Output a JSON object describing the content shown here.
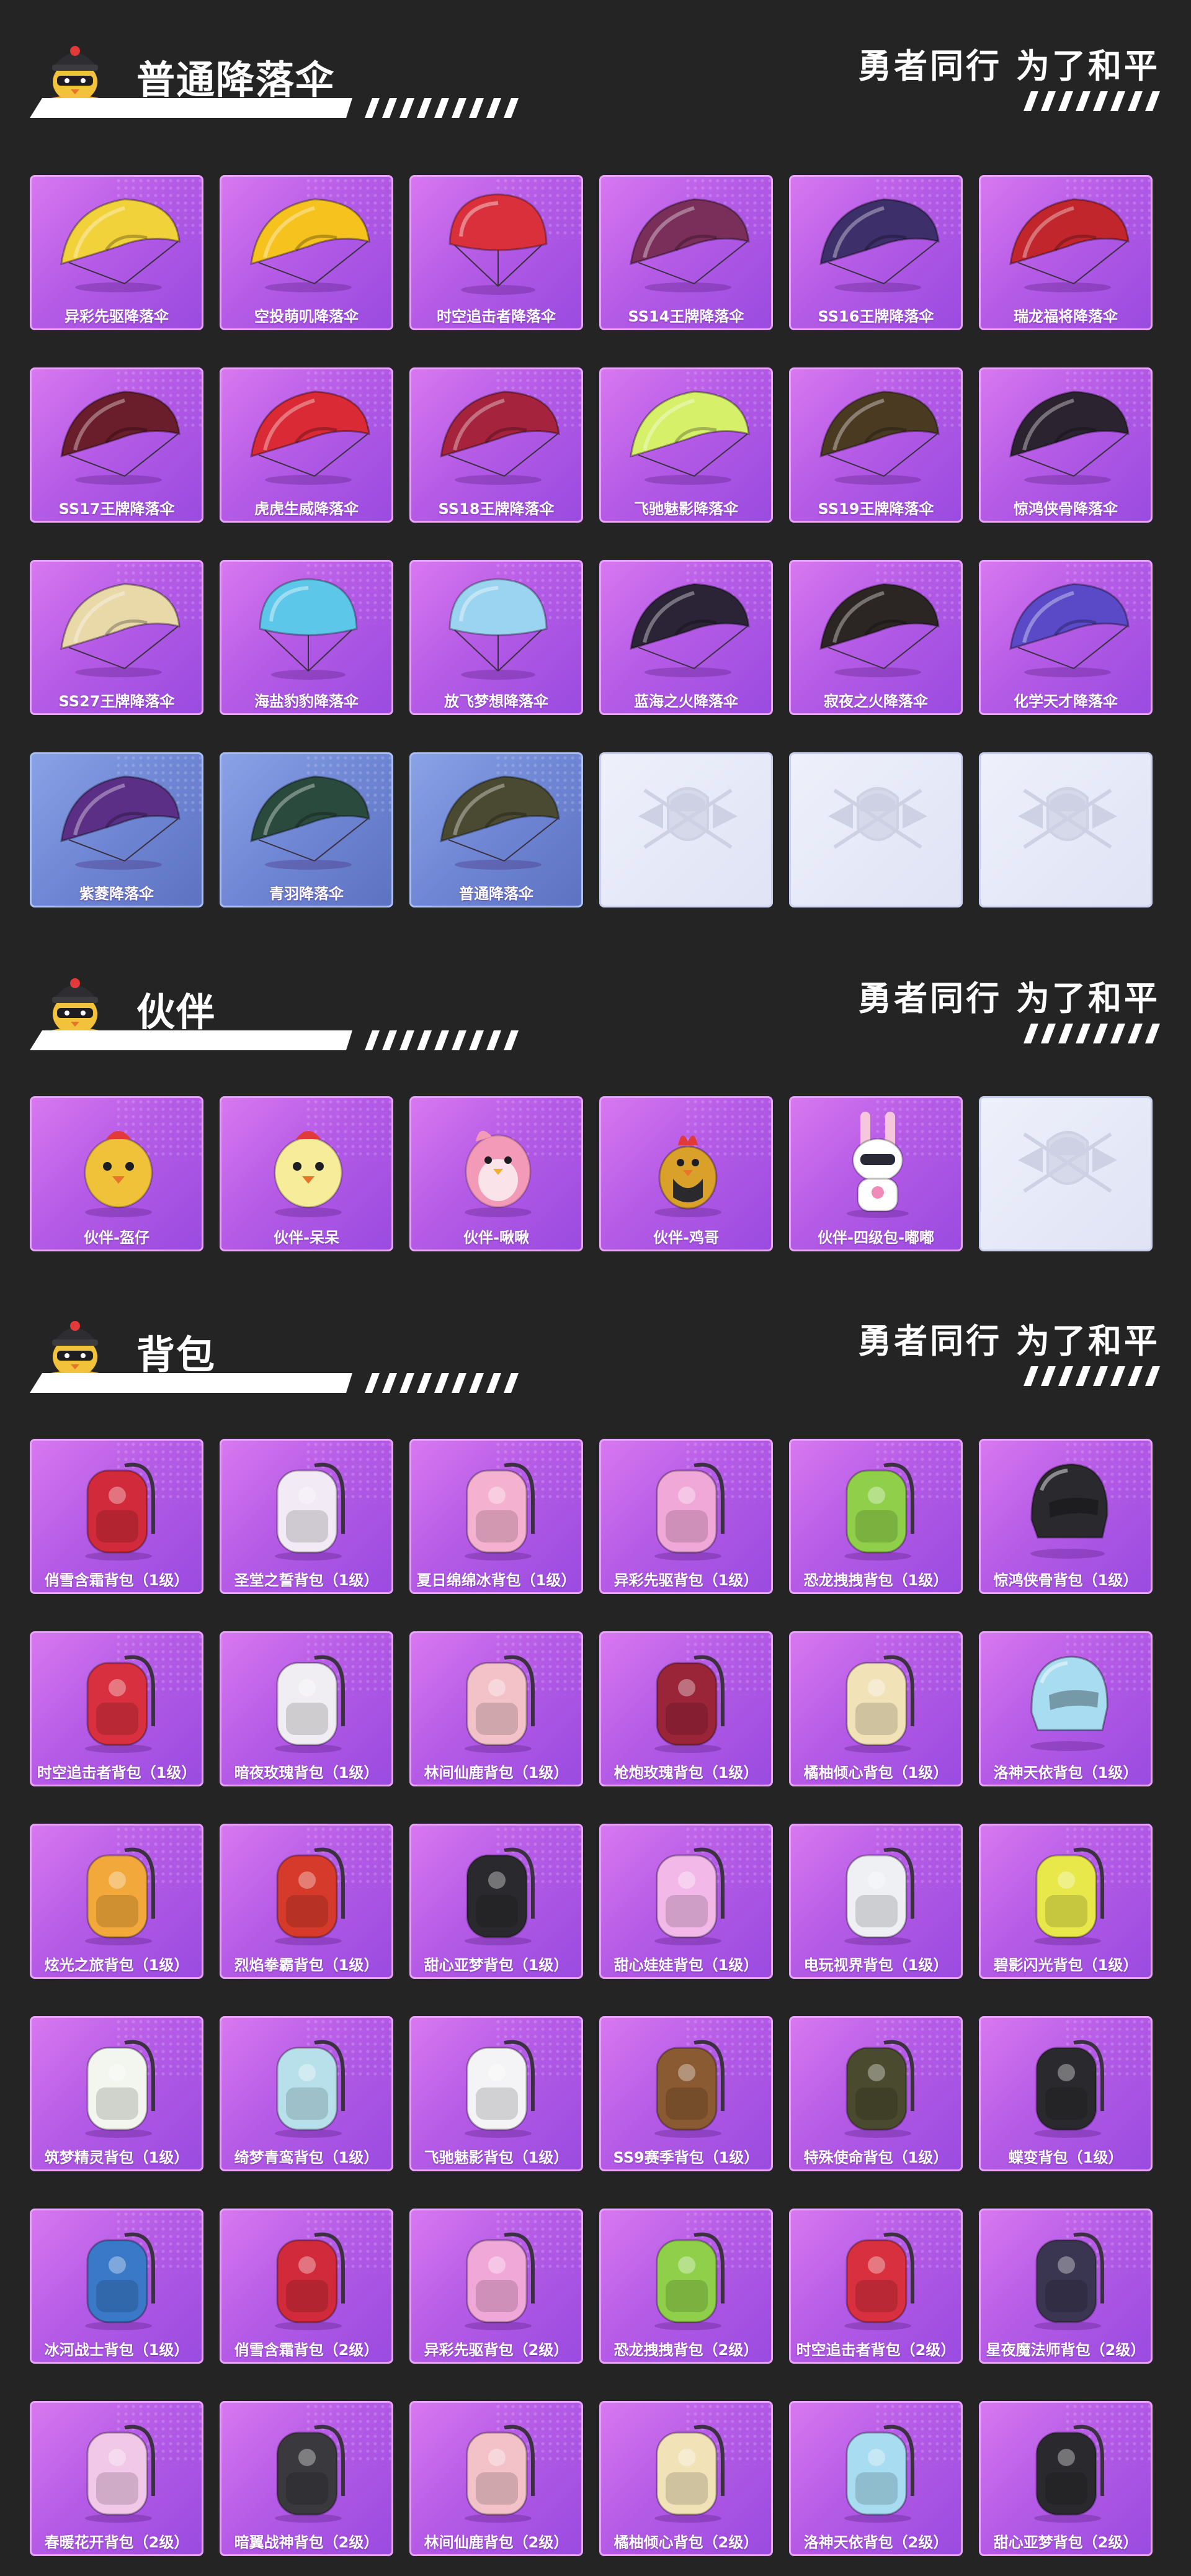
{
  "colors": {
    "page_bg": "#242424",
    "card_purple": "#b55be6",
    "card_blue": "#6f86d4",
    "card_empty": "#e6e9f7",
    "text": "#ffffff"
  },
  "slogan": "勇者同行 为了和平",
  "sections": [
    {
      "title": "普通降落伞",
      "items": [
        {
          "label": "异彩先驱降落伞",
          "style": "purple",
          "icon": "parachute-icon",
          "color": "#f2d23a"
        },
        {
          "label": "空投萌叽降落伞",
          "style": "purple",
          "icon": "parachute-icon",
          "color": "#f5c21e"
        },
        {
          "label": "时空追击者降落伞",
          "style": "purple",
          "icon": "parachute-round-icon",
          "color": "#d9303b"
        },
        {
          "label": "SS14王牌降落伞",
          "style": "purple",
          "icon": "parachute-icon",
          "color": "#7a2f5a"
        },
        {
          "label": "SS16王牌降落伞",
          "style": "purple",
          "icon": "parachute-icon",
          "color": "#3d2f6a"
        },
        {
          "label": "瑞龙福将降落伞",
          "style": "purple",
          "icon": "parachute-icon",
          "color": "#c2262d"
        },
        {
          "label": "SS17王牌降落伞",
          "style": "purple",
          "icon": "parachute-icon",
          "color": "#6a1d2a"
        },
        {
          "label": "虎虎生威降落伞",
          "style": "purple",
          "icon": "parachute-icon",
          "color": "#d92a35"
        },
        {
          "label": "SS18王牌降落伞",
          "style": "purple",
          "icon": "parachute-icon",
          "color": "#a5233c"
        },
        {
          "label": "飞驰魅影降落伞",
          "style": "purple",
          "icon": "parachute-icon",
          "color": "#d7f06a"
        },
        {
          "label": "SS19王牌降落伞",
          "style": "purple",
          "icon": "parachute-icon",
          "color": "#4a3a22"
        },
        {
          "label": "惊鸿侠骨降落伞",
          "style": "purple",
          "icon": "parachute-icon",
          "color": "#2b2330"
        },
        {
          "label": "SS27王牌降落伞",
          "style": "purple",
          "icon": "parachute-icon",
          "color": "#e9d8a8"
        },
        {
          "label": "海盐豹豹降落伞",
          "style": "purple",
          "icon": "parachute-round-icon",
          "color": "#5cc7e8"
        },
        {
          "label": "放飞梦想降落伞",
          "style": "purple",
          "icon": "parachute-round-icon",
          "color": "#9ad4f0"
        },
        {
          "label": "蓝海之火降落伞",
          "style": "purple",
          "icon": "parachute-icon",
          "color": "#2a2436"
        },
        {
          "label": "寂夜之火降落伞",
          "style": "purple",
          "icon": "parachute-icon",
          "color": "#2b2624"
        },
        {
          "label": "化学天才降落伞",
          "style": "purple",
          "icon": "parachute-icon",
          "color": "#5a4ac8"
        },
        {
          "label": "紫菱降落伞",
          "style": "blue",
          "icon": "parachute-icon",
          "color": "#5b2f86"
        },
        {
          "label": "青羽降落伞",
          "style": "blue",
          "icon": "parachute-icon",
          "color": "#2a4a3e"
        },
        {
          "label": "普通降落伞",
          "style": "blue",
          "icon": "parachute-icon",
          "color": "#4a4a32"
        },
        {
          "label": "",
          "style": "empty",
          "icon": "emblem-placeholder-icon",
          "color": "#c9cde0"
        },
        {
          "label": "",
          "style": "empty",
          "icon": "emblem-placeholder-icon",
          "color": "#c9cde0"
        },
        {
          "label": "",
          "style": "empty",
          "icon": "emblem-placeholder-icon",
          "color": "#c9cde0"
        }
      ]
    },
    {
      "title": "伙伴",
      "items": [
        {
          "label": "伙伴-盔仔",
          "style": "purple",
          "icon": "chick-companion-icon",
          "color": "#f0c23a"
        },
        {
          "label": "伙伴-呆呆",
          "style": "purple",
          "icon": "chick-companion-icon",
          "color": "#f6ec9a"
        },
        {
          "label": "伙伴-啾啾",
          "style": "purple",
          "icon": "bird-companion-icon",
          "color": "#f29ab8"
        },
        {
          "label": "伙伴-鸡哥",
          "style": "purple",
          "icon": "rooster-companion-icon",
          "color": "#d9a02a"
        },
        {
          "label": "伙伴-四级包-嘟嘟",
          "style": "purple",
          "icon": "rabbit-companion-icon",
          "color": "#ffffff"
        },
        {
          "label": "",
          "style": "empty",
          "icon": "emblem-placeholder-icon",
          "color": "#c9cde0"
        }
      ]
    },
    {
      "title": "背包",
      "items": [
        {
          "label": "俏雪含霜背包（1级）",
          "style": "purple",
          "icon": "backpack-icon",
          "color": "#d12a3a"
        },
        {
          "label": "圣堂之誓背包（1级）",
          "style": "purple",
          "icon": "backpack-icon",
          "color": "#f2eaf5"
        },
        {
          "label": "夏日绵绵冰背包（1级）",
          "style": "purple",
          "icon": "backpack-icon",
          "color": "#f5b2d0"
        },
        {
          "label": "异彩先驱背包（1级）",
          "style": "purple",
          "icon": "backpack-icon",
          "color": "#f0a8d8"
        },
        {
          "label": "恐龙拽拽背包（1级）",
          "style": "purple",
          "icon": "backpack-icon",
          "color": "#8fcf4a"
        },
        {
          "label": "惊鸿侠骨背包（1级）",
          "style": "purple",
          "icon": "helmet-bag-icon",
          "color": "#2a2a2e"
        },
        {
          "label": "时空追击者背包（1级）",
          "style": "purple",
          "icon": "backpack-icon",
          "color": "#d8303e"
        },
        {
          "label": "暗夜玫瑰背包（1级）",
          "style": "purple",
          "icon": "backpack-icon",
          "color": "#f0eef2"
        },
        {
          "label": "林间仙鹿背包（1级）",
          "style": "purple",
          "icon": "backpack-icon",
          "color": "#f2c2c8"
        },
        {
          "label": "枪炮玫瑰背包（1级）",
          "style": "purple",
          "icon": "backpack-icon",
          "color": "#9a2438"
        },
        {
          "label": "橘柚倾心背包（1级）",
          "style": "purple",
          "icon": "backpack-icon",
          "color": "#f2e2b8"
        },
        {
          "label": "洛神天依背包（1级）",
          "style": "purple",
          "icon": "helmet-bag-icon",
          "color": "#a8dcf0"
        },
        {
          "label": "炫光之旅背包（1级）",
          "style": "purple",
          "icon": "backpack-icon",
          "color": "#f2a83a"
        },
        {
          "label": "烈焰拳霸背包（1级）",
          "style": "purple",
          "icon": "backpack-icon",
          "color": "#d63a2a"
        },
        {
          "label": "甜心亚梦背包（1级）",
          "style": "purple",
          "icon": "backpack-icon",
          "color": "#2a2a2e"
        },
        {
          "label": "甜心娃娃背包（1级）",
          "style": "purple",
          "icon": "backpack-icon",
          "color": "#f2b8e8"
        },
        {
          "label": "电玩视界背包（1级）",
          "style": "purple",
          "icon": "backpack-icon",
          "color": "#eef0f4"
        },
        {
          "label": "碧影闪光背包（1级）",
          "style": "purple",
          "icon": "backpack-icon",
          "color": "#e8e84a"
        },
        {
          "label": "筑梦精灵背包（1级）",
          "style": "purple",
          "icon": "backpack-icon",
          "color": "#f2f6ee"
        },
        {
          "label": "绮梦青鸾背包（1级）",
          "style": "purple",
          "icon": "backpack-icon",
          "color": "#b8e0ea"
        },
        {
          "label": "飞驰魅影背包（1级）",
          "style": "purple",
          "icon": "backpack-icon",
          "color": "#f4f4f6"
        },
        {
          "label": "SS9赛季背包（1级）",
          "style": "purple",
          "icon": "backpack-icon",
          "color": "#8a5a32"
        },
        {
          "label": "特殊使命背包（1级）",
          "style": "purple",
          "icon": "backpack-icon",
          "color": "#4a4a2e"
        },
        {
          "label": "蝶变背包（1级）",
          "style": "purple",
          "icon": "backpack-icon",
          "color": "#2a2a2e"
        },
        {
          "label": "冰河战士背包（1级）",
          "style": "purple",
          "icon": "backpack-icon",
          "color": "#3a78c8"
        },
        {
          "label": "俏雪含霜背包（2级）",
          "style": "purple",
          "icon": "backpack-icon",
          "color": "#d12a3a"
        },
        {
          "label": "异彩先驱背包（2级）",
          "style": "purple",
          "icon": "backpack-icon",
          "color": "#f0a8d8"
        },
        {
          "label": "恐龙拽拽背包（2级）",
          "style": "purple",
          "icon": "backpack-icon",
          "color": "#8fcf4a"
        },
        {
          "label": "时空追击者背包（2级）",
          "style": "purple",
          "icon": "backpack-icon",
          "color": "#d8303e"
        },
        {
          "label": "星夜魔法师背包（2级）",
          "style": "purple",
          "icon": "backpack-icon",
          "color": "#3a3550"
        },
        {
          "label": "春暖花开背包（2级）",
          "style": "purple",
          "icon": "backpack-icon",
          "color": "#f2c8e8"
        },
        {
          "label": "暗翼战神背包（2级）",
          "style": "purple",
          "icon": "backpack-icon",
          "color": "#3a3a3e"
        },
        {
          "label": "林间仙鹿背包（2级）",
          "style": "purple",
          "icon": "backpack-icon",
          "color": "#f2c2c8"
        },
        {
          "label": "橘柚倾心背包（2级）",
          "style": "purple",
          "icon": "backpack-icon",
          "color": "#f2e2b8"
        },
        {
          "label": "洛神天依背包（2级）",
          "style": "purple",
          "icon": "backpack-icon",
          "color": "#a8dcf0"
        },
        {
          "label": "甜心亚梦背包（2级）",
          "style": "purple",
          "icon": "backpack-icon",
          "color": "#2a2a2e"
        }
      ]
    }
  ]
}
